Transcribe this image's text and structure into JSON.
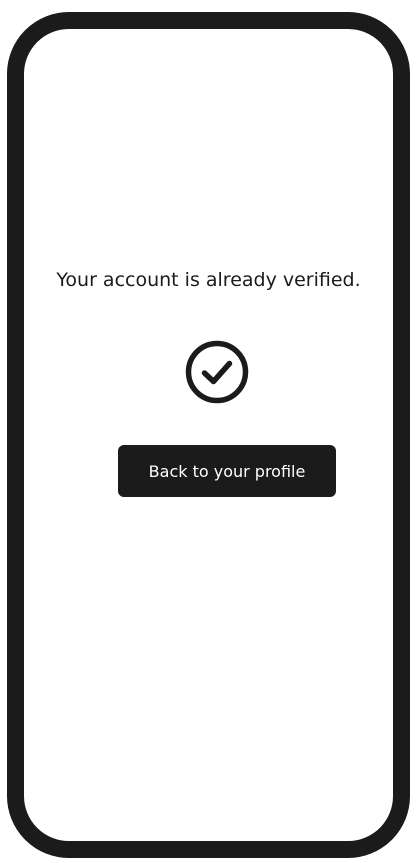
{
  "message": "Your account is already verified.",
  "icon": "check-circle-icon",
  "button": {
    "label": "Back to your profile"
  },
  "colors": {
    "frame": "#1b1b1b",
    "background": "#ffffff",
    "button_bg": "#1b1b1b",
    "button_text": "#ffffff"
  }
}
